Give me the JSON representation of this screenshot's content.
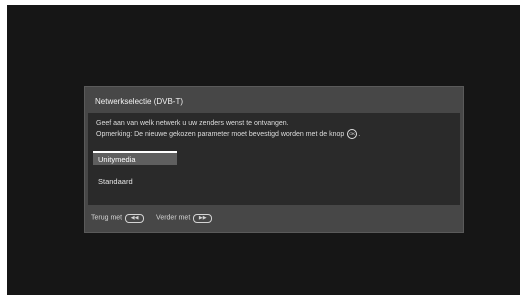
{
  "dialog": {
    "title": "Netwerkselectie (DVB-T)",
    "description_line1": "Geef aan van welk netwerk u uw zenders wenst te ontvangen.",
    "description_line2": "Opmerking: De nieuwe gekozen parameter moet bevestigd worden met de knop",
    "description_line2_end": ".",
    "ok_icon_glyph": "OK",
    "options": [
      {
        "label": "Unitymedia",
        "selected": true
      },
      {
        "label": "Standaard",
        "selected": false
      }
    ]
  },
  "footer": {
    "back_label": "Terug met",
    "back_icon_glyph": "◀◀",
    "next_label": "Verder met",
    "next_icon_glyph": "▶▶"
  },
  "colors": {
    "screen_bg": "#161616",
    "dialog_bg": "#474747",
    "panel_bg": "#2a2a2a",
    "selection_bg": "#5f5f5f"
  }
}
